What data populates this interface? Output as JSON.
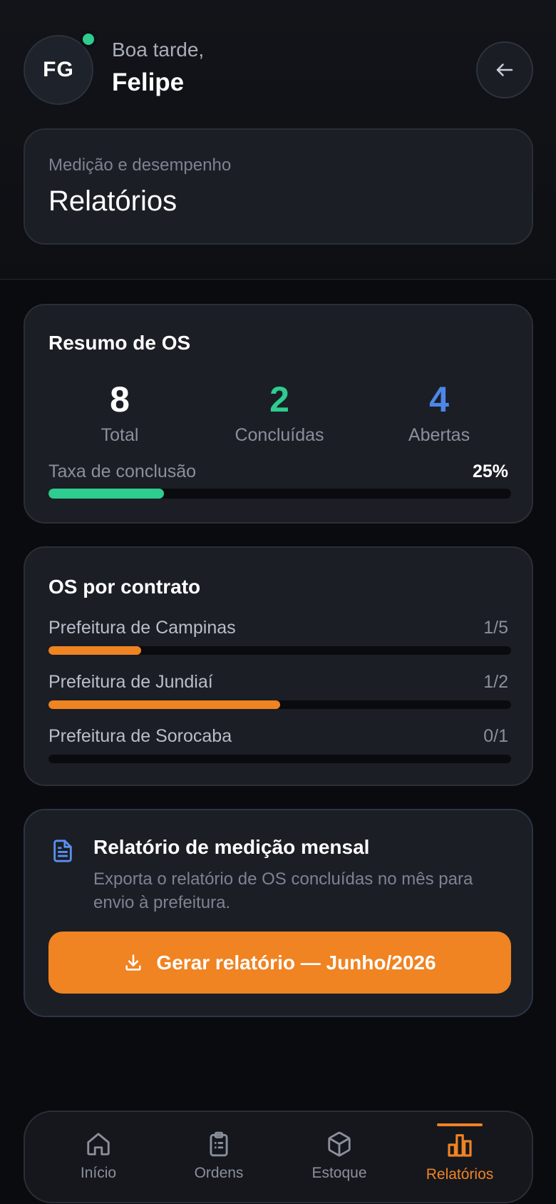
{
  "user": {
    "initials": "FG",
    "greeting": "Boa tarde,",
    "name": "Felipe",
    "status": "online"
  },
  "header": {
    "subtitle": "Medição e desempenho",
    "title": "Relatórios"
  },
  "summary": {
    "title": "Resumo de OS",
    "stats": [
      {
        "value": "8",
        "label": "Total",
        "color": "#ffffff"
      },
      {
        "value": "2",
        "label": "Concluídas",
        "color": "#2ecc8f"
      },
      {
        "value": "4",
        "label": "Abertas",
        "color": "#4d87e6"
      }
    ],
    "completion_label": "Taxa de conclusão",
    "completion_value": "25%",
    "completion_fraction": 0.25
  },
  "contracts": {
    "title": "OS por contrato",
    "items": [
      {
        "name": "Prefeitura de Campinas",
        "count": "1/5",
        "fraction": 0.2
      },
      {
        "name": "Prefeitura de Jundiaí",
        "count": "1/2",
        "fraction": 0.5
      },
      {
        "name": "Prefeitura de Sorocaba",
        "count": "0/1",
        "fraction": 0
      }
    ]
  },
  "report": {
    "title": "Relatório de medição mensal",
    "description": "Exporta o relatório de OS concluídas no mês para envio à prefeitura.",
    "button_label": "Gerar relatório — Junho/2026"
  },
  "nav": {
    "items": [
      {
        "label": "Início",
        "icon": "home-icon",
        "active": false
      },
      {
        "label": "Ordens",
        "icon": "clipboard-icon",
        "active": false
      },
      {
        "label": "Estoque",
        "icon": "box-icon",
        "active": false
      },
      {
        "label": "Relatórios",
        "icon": "bar-chart-icon",
        "active": true
      }
    ]
  },
  "colors": {
    "accent": "#f08322",
    "success": "#2ecc8f",
    "info": "#4d87e6",
    "background": "#0a0b0e",
    "card": "#1b1e25"
  }
}
